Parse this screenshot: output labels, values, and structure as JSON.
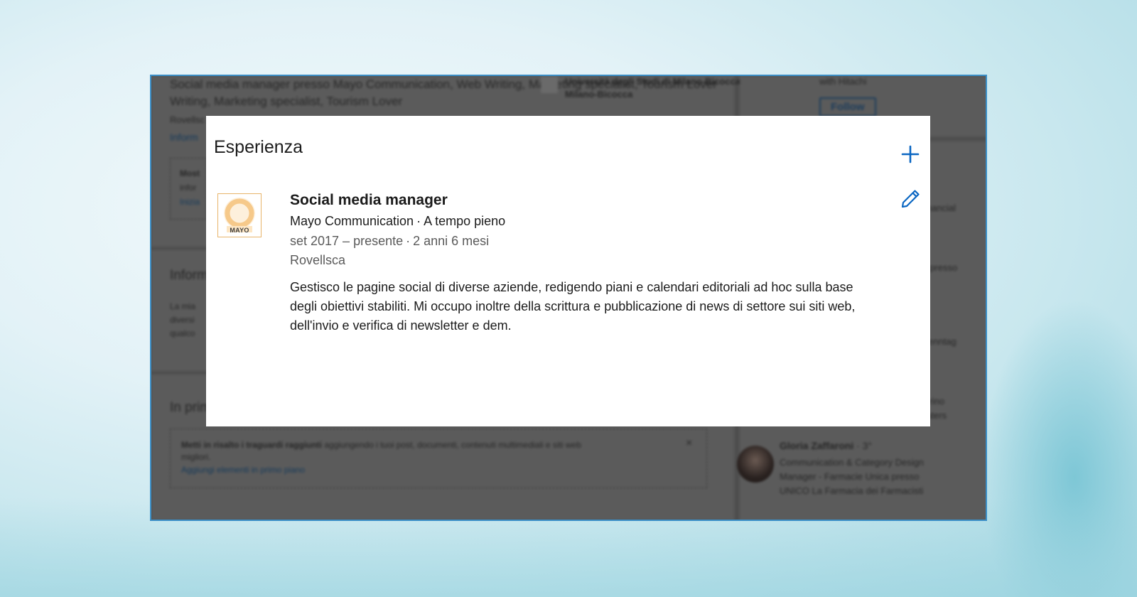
{
  "background_page": {
    "headline": "Social media manager presso Mayo Communication, Web Writing, Marketing specialist, Tourism Lover",
    "headline_line2": "Writing, Marketing specialist, Tourism Lover",
    "location_fragment": "Rovellsc",
    "info_link_fragment": "Inform",
    "show_box_line1": "Most",
    "show_box_line2": "infor",
    "show_box_link": "Inizia",
    "university": "Università degli Studi di Milano-Bicocca",
    "university_line2": "Milano-Bicocca",
    "section_info_title": "Inform",
    "section_info_text1": "La mia",
    "section_info_text2": "diversi",
    "section_info_text3": "qualco",
    "section_featured_title": "In prim",
    "featured_tip_bold": "Metti in risalto i traguardi raggiunti",
    "featured_tip_text": " aggiungendo i tuoi post, documenti, contenuti multimediali e siti web",
    "featured_tip_text2": "migliori.",
    "featured_tip_link": "Aggiungi elementi in primo piano",
    "close_symbol": "×",
    "sidebar_company_line": "with Hitachi",
    "follow_label": "Follow",
    "sidebar_fragment1": "Financial",
    "sidebar_fragment2": "er presso",
    "sidebar_fragment3": "Brenntag",
    "sidebar_fragment4": "egrino",
    "sidebar_fragment5": "ulaters",
    "person_name": "Gloria Zaffaroni",
    "person_degree": " · 3°",
    "person_title1": "Communication & Category Design",
    "person_title2": "Manager - Farmacie Unica presso",
    "person_title3": "UNICO La Farmacia dei Farmacisti"
  },
  "modal": {
    "title": "Esperienza",
    "add_icon": "plus-icon",
    "edit_icon": "pencil-icon",
    "accent_color": "#0a66c2",
    "experience": {
      "logo_text": "MAYO",
      "role": "Social media manager",
      "company": "Mayo Communication",
      "employment_type": "A tempo pieno",
      "date_range": "set 2017 – presente",
      "duration": "2 anni 6 mesi",
      "location": "Rovellsca",
      "description": "Gestisco le pagine social di diverse aziende, redigendo piani e calendari editoriali ad hoc sulla base degli obiettivi stabiliti. Mi occupo inoltre della scrittura e pubblicazione di news di settore sui siti web, dell'invio e verifica di newsletter e dem."
    }
  }
}
